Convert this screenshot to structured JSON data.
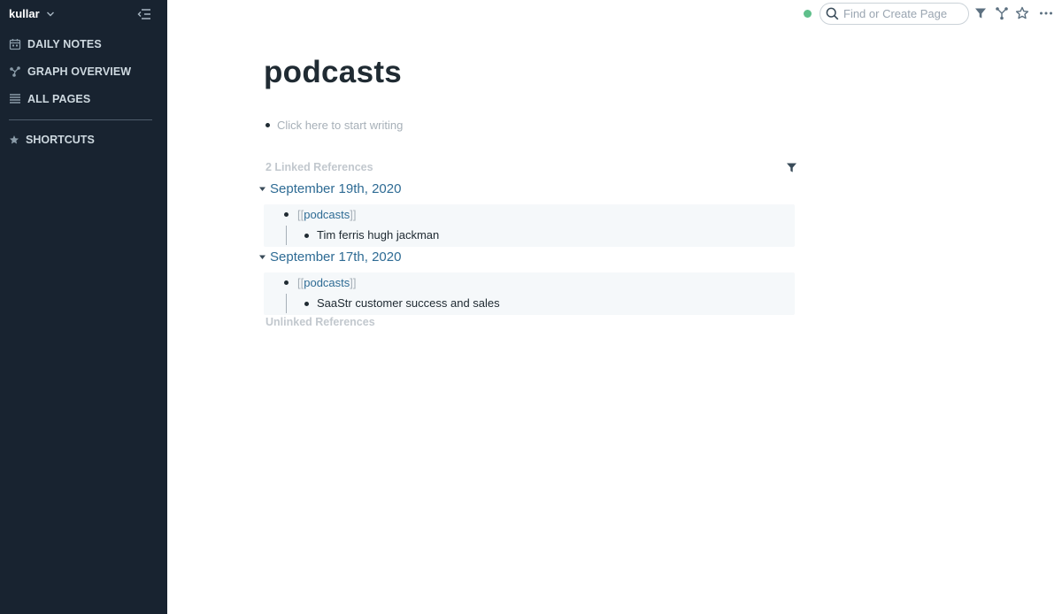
{
  "sidebar": {
    "graph_name": "kullar",
    "nav": {
      "daily_notes": "DAILY NOTES",
      "graph_overview": "GRAPH OVERVIEW",
      "all_pages": "ALL PAGES"
    },
    "shortcuts": "SHORTCUTS"
  },
  "topbar": {
    "search_placeholder": "Find or Create Page",
    "status": "synced"
  },
  "page": {
    "title": "podcasts",
    "placeholder": "Click here to start writing",
    "linked_references_title": "2 Linked References",
    "references": [
      {
        "date": "September 19th, 2020",
        "link": "podcasts",
        "child": "Tim ferris hugh jackman"
      },
      {
        "date": "September 17th, 2020",
        "link": "podcasts",
        "child": "SaaStr customer success and sales"
      }
    ],
    "unlinked_references_title": "Unlinked References"
  },
  "colors": {
    "sidebar_bg": "#182330",
    "link": "#2e6b94",
    "status_dot": "#5fbf8b"
  }
}
